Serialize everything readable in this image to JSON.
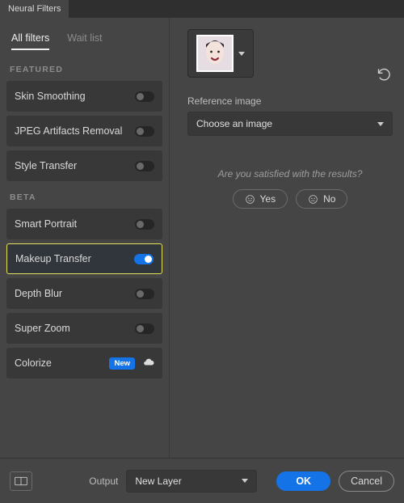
{
  "window": {
    "tab_title": "Neural Filters"
  },
  "tabs": {
    "all": "All filters",
    "wait": "Wait list"
  },
  "sections": {
    "featured": "FEATURED",
    "beta": "BETA"
  },
  "filters": {
    "featured": [
      {
        "name": "Skin Smoothing",
        "on": false
      },
      {
        "name": "JPEG Artifacts Removal",
        "on": false
      },
      {
        "name": "Style Transfer",
        "on": false
      }
    ],
    "beta": [
      {
        "name": "Smart Portrait",
        "on": false
      },
      {
        "name": "Makeup Transfer",
        "on": true,
        "selected": true
      },
      {
        "name": "Depth Blur",
        "on": false
      },
      {
        "name": "Super Zoom",
        "on": false
      },
      {
        "name": "Colorize",
        "on": false,
        "badge": "New",
        "download": true
      }
    ]
  },
  "right": {
    "reference_label": "Reference image",
    "reference_value": "Choose an image",
    "satisfied_prompt": "Are you satisfied with the results?",
    "yes": "Yes",
    "no": "No"
  },
  "footer": {
    "output_label": "Output",
    "output_value": "New Layer",
    "ok": "OK",
    "cancel": "Cancel"
  }
}
